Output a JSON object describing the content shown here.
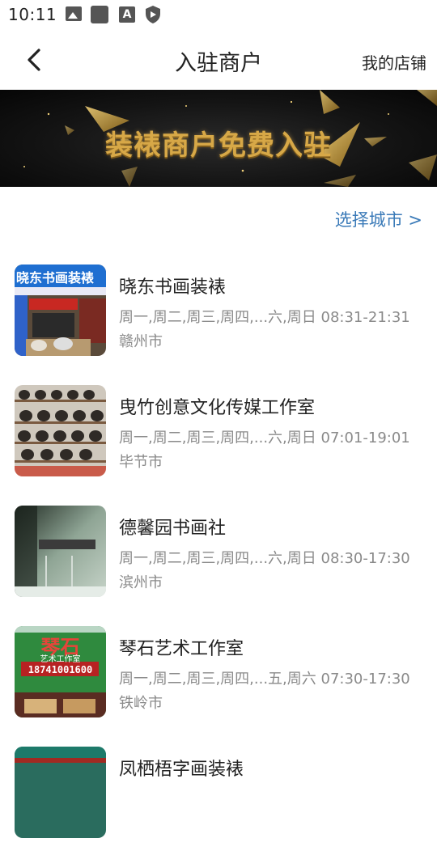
{
  "status_bar": {
    "time": "10:11",
    "icons": [
      "photo-icon",
      "square-icon",
      "a-icon",
      "shield-icon"
    ]
  },
  "nav": {
    "title": "入驻商户",
    "right_link": "我的店铺",
    "back_icon": "back-arrow-icon"
  },
  "banner": {
    "text": "装裱商户免费入驻"
  },
  "select_city": "选择城市 >",
  "shops": [
    {
      "name": "晓东书画装裱",
      "hours": "周一,周二,周三,周四,...六,周日 08:31-21:31",
      "city": "赣州市",
      "sign": "晓东书画装裱"
    },
    {
      "name": "曳竹创意文化传媒工作室",
      "hours": "周一,周二,周三,周四,...六,周日 07:01-19:01",
      "city": "毕节市"
    },
    {
      "name": "德馨园书画社",
      "hours": "周一,周二,周三,周四,...六,周日 08:30-17:30",
      "city": "滨州市"
    },
    {
      "name": "琴石艺术工作室",
      "hours": "周一,周二,周三,周四,...五,周六 07:30-17:30",
      "city": "铁岭市",
      "sign": "琴石",
      "sign_sub": "艺术工作室",
      "sign_phone": "18741001600"
    },
    {
      "name": "凤栖梧字画装裱",
      "hours": "",
      "city": ""
    }
  ],
  "colors": {
    "accent_link": "#3a7ab8",
    "banner_gold": "#d7a847",
    "meta_text": "#8a8a8a"
  }
}
